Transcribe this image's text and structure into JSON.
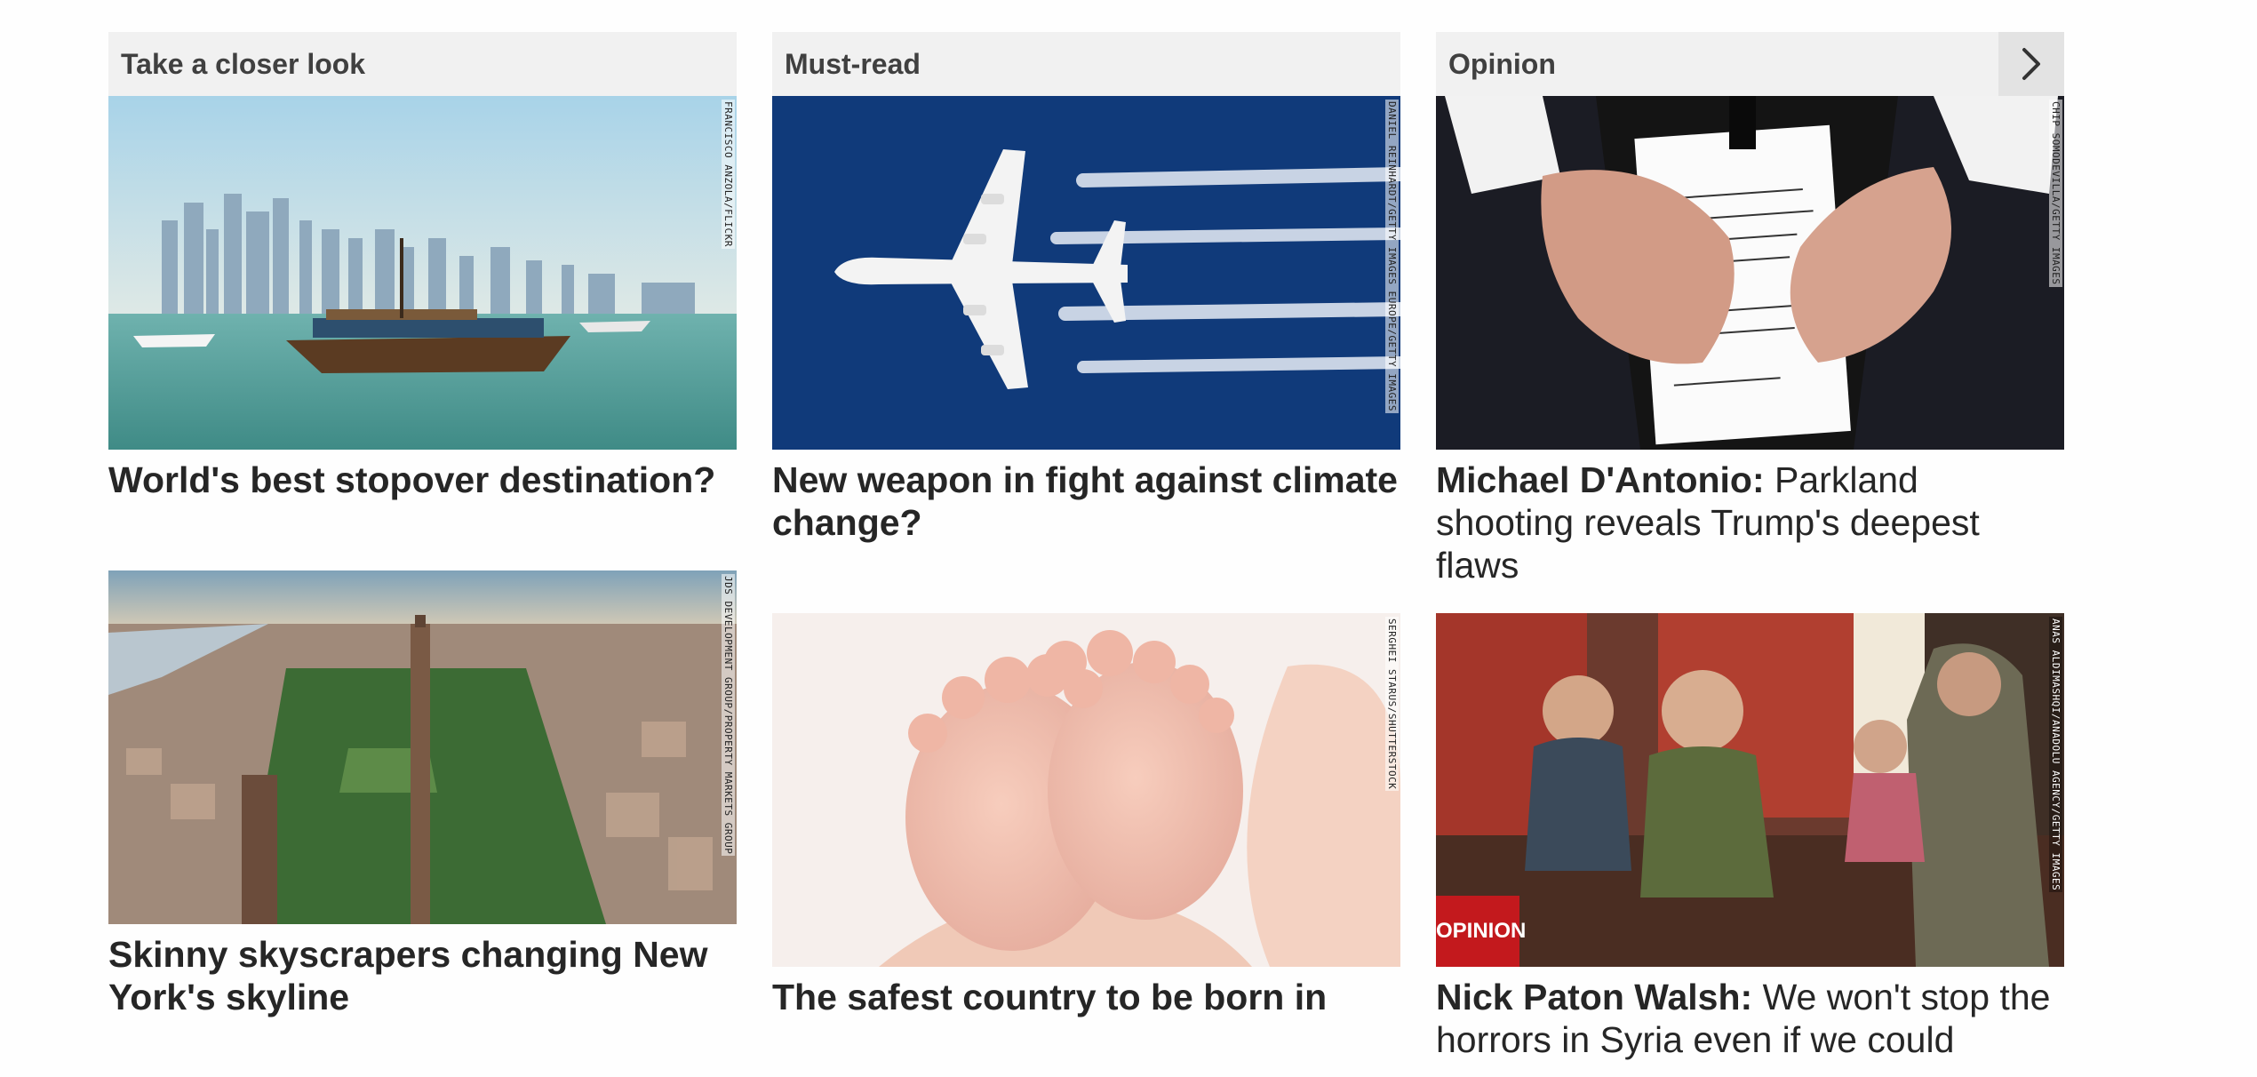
{
  "sections": {
    "closer_look": {
      "label": "Take a closer look"
    },
    "must_read": {
      "label": "Must-read"
    },
    "opinion": {
      "label": "Opinion",
      "next_icon": "chevron-right-icon"
    }
  },
  "cards": {
    "stopover": {
      "headline": "World's best stopover destination?",
      "credit": "FRANCISCO ANZOLA/FLICKR"
    },
    "climate": {
      "headline": "New weapon in fight against climate change?",
      "credit": "DANIEL REINHARDT/GETTY IMAGES EUROPE/GETTY IMAGES"
    },
    "parkland": {
      "author": "Michael D'Antonio:",
      "headline": "Parkland shooting reveals Trump's deepest flaws",
      "credit": "CHIP SOMODEVILLA/GETTY IMAGES"
    },
    "skyscrapers": {
      "headline": "Skinny skyscrapers changing New York's skyline",
      "credit": "JDS DEVELOPMENT GROUP/PROPERTY MARKETS GROUP"
    },
    "safest": {
      "headline": "The safest country to be born in",
      "credit": "SERGHEI STARUS/SHUTTERSTOCK"
    },
    "syria": {
      "author": "Nick Paton Walsh:",
      "headline": "We won't stop the horrors in Syria even if we could",
      "badge": "OPINION",
      "credit": "ANAS ALDIMASHQI/ANADOLU AGENCY/GETTY IMAGES"
    }
  },
  "colors": {
    "header_bg": "#f1f1f1",
    "header_text": "#404040",
    "opinion_red": "#c3191d",
    "headline_text": "#262626"
  }
}
